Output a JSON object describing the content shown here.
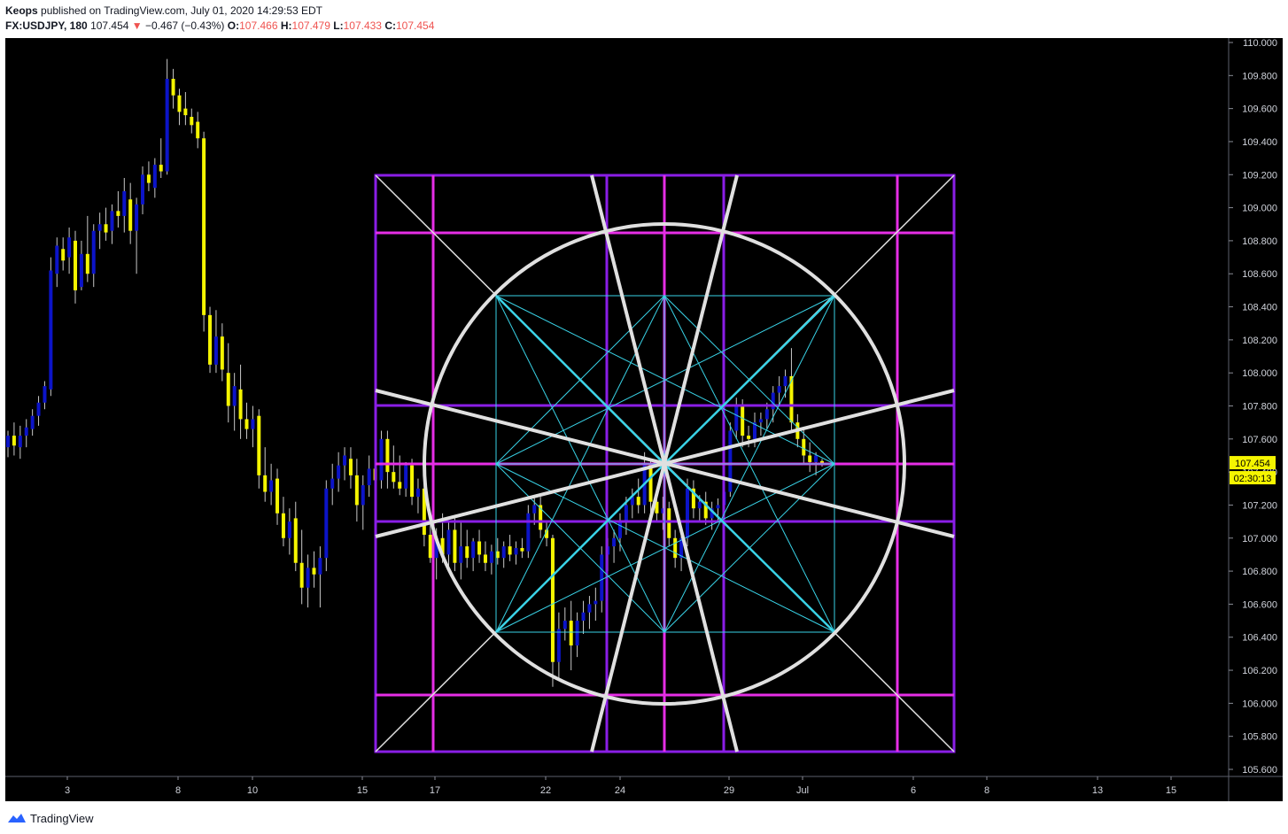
{
  "header": {
    "author": "Keops",
    "published_text": "published on TradingView.com, July 01, 2020 14:29:53 EDT",
    "symbol": "FX:USDJPY, 180",
    "last": "107.454",
    "change_arrow": "▼",
    "change": "−0.467 (−0.43%)",
    "o_label": "O:",
    "o_value": "107.466",
    "h_label": "H:",
    "h_value": "107.479",
    "l_label": "L:",
    "l_value": "107.433",
    "c_label": "C:",
    "c_value": "107.454"
  },
  "footer": {
    "brand": "TradingView",
    "logo_icon": "tradingview-logo-icon"
  },
  "colors": {
    "background": "#000000",
    "candle_up": "#0c14c8",
    "candle_down": "#f5f500",
    "frame": "#8a1ee6",
    "grid_magenta": "#e62ee6",
    "circle_and_rays": "#e0e0e0",
    "inner_lines": "#39d2e6",
    "price_tag_bg": "#f5f500"
  },
  "chart_data": {
    "type": "candlestick",
    "ylim": [
      105.55,
      110.04
    ],
    "y_ticks": [
      "110.000",
      "109.800",
      "109.600",
      "109.400",
      "109.200",
      "109.000",
      "108.800",
      "108.600",
      "108.400",
      "108.200",
      "108.000",
      "107.800",
      "107.600",
      "107.400",
      "107.200",
      "107.000",
      "106.800",
      "106.600",
      "106.400",
      "106.200",
      "106.000",
      "105.800",
      "105.600"
    ],
    "x_ticks": [
      "3",
      "8",
      "10",
      "15",
      "17",
      "22",
      "24",
      "29",
      "Jul",
      "6",
      "8",
      "13",
      "15"
    ],
    "last_price_label": "107.454",
    "countdown_label": "02:30:13",
    "candles": [
      {
        "o": 107.55,
        "h": 107.65,
        "l": 107.49,
        "c": 107.62
      },
      {
        "o": 107.62,
        "h": 107.7,
        "l": 107.5,
        "c": 107.56
      },
      {
        "o": 107.55,
        "h": 107.68,
        "l": 107.48,
        "c": 107.62
      },
      {
        "o": 107.62,
        "h": 107.72,
        "l": 107.55,
        "c": 107.67
      },
      {
        "o": 107.66,
        "h": 107.78,
        "l": 107.62,
        "c": 107.74
      },
      {
        "o": 107.74,
        "h": 107.86,
        "l": 107.68,
        "c": 107.82
      },
      {
        "o": 107.82,
        "h": 107.95,
        "l": 107.78,
        "c": 107.92
      },
      {
        "o": 107.9,
        "h": 108.7,
        "l": 107.86,
        "c": 108.62
      },
      {
        "o": 108.6,
        "h": 108.82,
        "l": 108.52,
        "c": 108.77
      },
      {
        "o": 108.75,
        "h": 108.82,
        "l": 108.62,
        "c": 108.68
      },
      {
        "o": 108.7,
        "h": 108.88,
        "l": 108.6,
        "c": 108.82
      },
      {
        "o": 108.8,
        "h": 108.86,
        "l": 108.42,
        "c": 108.5
      },
      {
        "o": 108.52,
        "h": 108.8,
        "l": 108.5,
        "c": 108.72
      },
      {
        "o": 108.72,
        "h": 108.95,
        "l": 108.55,
        "c": 108.6
      },
      {
        "o": 108.6,
        "h": 108.9,
        "l": 108.52,
        "c": 108.86
      },
      {
        "o": 108.86,
        "h": 108.97,
        "l": 108.75,
        "c": 108.9
      },
      {
        "o": 108.9,
        "h": 109.0,
        "l": 108.8,
        "c": 108.85
      },
      {
        "o": 108.86,
        "h": 109.02,
        "l": 108.78,
        "c": 108.98
      },
      {
        "o": 108.98,
        "h": 109.1,
        "l": 108.88,
        "c": 108.95
      },
      {
        "o": 108.95,
        "h": 109.18,
        "l": 108.85,
        "c": 109.1
      },
      {
        "o": 109.05,
        "h": 109.15,
        "l": 108.78,
        "c": 108.86
      },
      {
        "o": 108.86,
        "h": 109.06,
        "l": 108.6,
        "c": 109.02
      },
      {
        "o": 109.02,
        "h": 109.25,
        "l": 108.96,
        "c": 109.2
      },
      {
        "o": 109.2,
        "h": 109.28,
        "l": 109.1,
        "c": 109.15
      },
      {
        "o": 109.12,
        "h": 109.3,
        "l": 109.06,
        "c": 109.26
      },
      {
        "o": 109.26,
        "h": 109.42,
        "l": 109.18,
        "c": 109.22
      },
      {
        "o": 109.22,
        "h": 109.9,
        "l": 109.2,
        "c": 109.78
      },
      {
        "o": 109.78,
        "h": 109.84,
        "l": 109.6,
        "c": 109.68
      },
      {
        "o": 109.68,
        "h": 109.72,
        "l": 109.5,
        "c": 109.58
      },
      {
        "o": 109.6,
        "h": 109.7,
        "l": 109.5,
        "c": 109.56
      },
      {
        "o": 109.55,
        "h": 109.6,
        "l": 109.45,
        "c": 109.5
      },
      {
        "o": 109.52,
        "h": 109.58,
        "l": 109.36,
        "c": 109.42
      },
      {
        "o": 109.42,
        "h": 109.46,
        "l": 108.25,
        "c": 108.35
      },
      {
        "o": 108.35,
        "h": 108.4,
        "l": 108.0,
        "c": 108.05
      },
      {
        "o": 108.05,
        "h": 108.38,
        "l": 108.0,
        "c": 108.22
      },
      {
        "o": 108.22,
        "h": 108.3,
        "l": 107.95,
        "c": 108.02
      },
      {
        "o": 108.0,
        "h": 108.18,
        "l": 107.7,
        "c": 107.8
      },
      {
        "o": 107.8,
        "h": 108.0,
        "l": 107.65,
        "c": 107.92
      },
      {
        "o": 107.9,
        "h": 108.05,
        "l": 107.6,
        "c": 107.72
      },
      {
        "o": 107.72,
        "h": 107.82,
        "l": 107.6,
        "c": 107.66
      },
      {
        "o": 107.66,
        "h": 107.8,
        "l": 107.55,
        "c": 107.72
      },
      {
        "o": 107.74,
        "h": 107.78,
        "l": 107.3,
        "c": 107.38
      },
      {
        "o": 107.38,
        "h": 107.55,
        "l": 107.22,
        "c": 107.28
      },
      {
        "o": 107.28,
        "h": 107.45,
        "l": 107.2,
        "c": 107.35
      },
      {
        "o": 107.36,
        "h": 107.42,
        "l": 107.08,
        "c": 107.15
      },
      {
        "o": 107.15,
        "h": 107.25,
        "l": 106.95,
        "c": 107.0
      },
      {
        "o": 107.0,
        "h": 107.18,
        "l": 106.9,
        "c": 107.1
      },
      {
        "o": 107.12,
        "h": 107.22,
        "l": 106.8,
        "c": 106.85
      },
      {
        "o": 106.85,
        "h": 107.05,
        "l": 106.6,
        "c": 106.7
      },
      {
        "o": 106.7,
        "h": 106.9,
        "l": 106.58,
        "c": 106.82
      },
      {
        "o": 106.82,
        "h": 106.92,
        "l": 106.7,
        "c": 106.78
      },
      {
        "o": 106.78,
        "h": 106.95,
        "l": 106.58,
        "c": 106.88
      },
      {
        "o": 106.88,
        "h": 107.35,
        "l": 106.8,
        "c": 107.3
      },
      {
        "o": 107.3,
        "h": 107.45,
        "l": 107.2,
        "c": 107.36
      },
      {
        "o": 107.36,
        "h": 107.52,
        "l": 107.28,
        "c": 107.44
      },
      {
        "o": 107.44,
        "h": 107.55,
        "l": 107.35,
        "c": 107.5
      },
      {
        "o": 107.48,
        "h": 107.55,
        "l": 107.3,
        "c": 107.38
      },
      {
        "o": 107.38,
        "h": 107.48,
        "l": 107.1,
        "c": 107.2
      },
      {
        "o": 107.2,
        "h": 107.38,
        "l": 107.05,
        "c": 107.32
      },
      {
        "o": 107.32,
        "h": 107.5,
        "l": 107.25,
        "c": 107.42
      },
      {
        "o": 107.42,
        "h": 107.6,
        "l": 107.3,
        "c": 107.35
      },
      {
        "o": 107.35,
        "h": 107.65,
        "l": 107.3,
        "c": 107.6
      },
      {
        "o": 107.6,
        "h": 107.65,
        "l": 107.3,
        "c": 107.4
      },
      {
        "o": 107.4,
        "h": 107.56,
        "l": 107.3,
        "c": 107.34
      },
      {
        "o": 107.34,
        "h": 107.5,
        "l": 107.26,
        "c": 107.3
      },
      {
        "o": 107.3,
        "h": 107.46,
        "l": 107.25,
        "c": 107.44
      },
      {
        "o": 107.44,
        "h": 107.48,
        "l": 107.2,
        "c": 107.25
      },
      {
        "o": 107.25,
        "h": 107.36,
        "l": 107.15,
        "c": 107.3
      },
      {
        "o": 107.3,
        "h": 107.34,
        "l": 106.95,
        "c": 107.02
      },
      {
        "o": 107.02,
        "h": 107.1,
        "l": 106.85,
        "c": 106.88
      },
      {
        "o": 106.88,
        "h": 107.06,
        "l": 106.75,
        "c": 107.0
      },
      {
        "o": 107.0,
        "h": 107.15,
        "l": 106.85,
        "c": 106.9
      },
      {
        "o": 106.9,
        "h": 107.1,
        "l": 106.8,
        "c": 107.05
      },
      {
        "o": 107.05,
        "h": 107.12,
        "l": 106.8,
        "c": 106.85
      },
      {
        "o": 106.85,
        "h": 107.1,
        "l": 106.75,
        "c": 106.95
      },
      {
        "o": 106.95,
        "h": 107.05,
        "l": 106.82,
        "c": 106.88
      },
      {
        "o": 106.88,
        "h": 107.0,
        "l": 106.8,
        "c": 106.98
      },
      {
        "o": 106.98,
        "h": 107.05,
        "l": 106.85,
        "c": 106.9
      },
      {
        "o": 106.9,
        "h": 106.98,
        "l": 106.8,
        "c": 106.85
      },
      {
        "o": 106.85,
        "h": 106.96,
        "l": 106.78,
        "c": 106.92
      },
      {
        "o": 106.92,
        "h": 107.0,
        "l": 106.84,
        "c": 106.88
      },
      {
        "o": 106.88,
        "h": 106.98,
        "l": 106.82,
        "c": 106.95
      },
      {
        "o": 106.95,
        "h": 107.02,
        "l": 106.86,
        "c": 106.9
      },
      {
        "o": 106.9,
        "h": 106.98,
        "l": 106.84,
        "c": 106.94
      },
      {
        "o": 106.94,
        "h": 107.0,
        "l": 106.88,
        "c": 106.92
      },
      {
        "o": 106.92,
        "h": 107.2,
        "l": 106.88,
        "c": 107.15
      },
      {
        "o": 107.15,
        "h": 107.25,
        "l": 107.08,
        "c": 107.2
      },
      {
        "o": 107.2,
        "h": 107.25,
        "l": 107.0,
        "c": 107.05
      },
      {
        "o": 107.05,
        "h": 107.1,
        "l": 106.95,
        "c": 107.0
      },
      {
        "o": 107.0,
        "h": 107.02,
        "l": 106.1,
        "c": 106.25
      },
      {
        "o": 106.25,
        "h": 106.55,
        "l": 106.15,
        "c": 106.45
      },
      {
        "o": 106.45,
        "h": 106.58,
        "l": 106.38,
        "c": 106.5
      },
      {
        "o": 106.5,
        "h": 106.62,
        "l": 106.2,
        "c": 106.35
      },
      {
        "o": 106.35,
        "h": 106.55,
        "l": 106.28,
        "c": 106.5
      },
      {
        "o": 106.5,
        "h": 106.62,
        "l": 106.42,
        "c": 106.55
      },
      {
        "o": 106.55,
        "h": 106.65,
        "l": 106.45,
        "c": 106.6
      },
      {
        "o": 106.6,
        "h": 106.7,
        "l": 106.5,
        "c": 106.62
      },
      {
        "o": 106.62,
        "h": 106.95,
        "l": 106.55,
        "c": 106.9
      },
      {
        "o": 106.9,
        "h": 107.0,
        "l": 106.8,
        "c": 106.95
      },
      {
        "o": 106.95,
        "h": 107.05,
        "l": 106.85,
        "c": 107.0
      },
      {
        "o": 107.0,
        "h": 107.15,
        "l": 106.92,
        "c": 107.1
      },
      {
        "o": 107.1,
        "h": 107.25,
        "l": 107.02,
        "c": 107.2
      },
      {
        "o": 107.2,
        "h": 107.3,
        "l": 107.12,
        "c": 107.25
      },
      {
        "o": 107.25,
        "h": 107.36,
        "l": 107.15,
        "c": 107.2
      },
      {
        "o": 107.2,
        "h": 107.52,
        "l": 107.15,
        "c": 107.45
      },
      {
        "o": 107.45,
        "h": 107.48,
        "l": 107.15,
        "c": 107.22
      },
      {
        "o": 107.22,
        "h": 107.3,
        "l": 107.1,
        "c": 107.15
      },
      {
        "o": 107.15,
        "h": 107.25,
        "l": 107.05,
        "c": 107.18
      },
      {
        "o": 107.18,
        "h": 107.22,
        "l": 106.95,
        "c": 107.0
      },
      {
        "o": 107.0,
        "h": 107.05,
        "l": 106.82,
        "c": 106.88
      },
      {
        "o": 106.88,
        "h": 107.05,
        "l": 106.8,
        "c": 107.0
      },
      {
        "o": 107.0,
        "h": 107.36,
        "l": 106.95,
        "c": 107.3
      },
      {
        "o": 107.3,
        "h": 107.35,
        "l": 107.12,
        "c": 107.18
      },
      {
        "o": 107.18,
        "h": 107.26,
        "l": 107.1,
        "c": 107.22
      },
      {
        "o": 107.22,
        "h": 107.28,
        "l": 107.08,
        "c": 107.12
      },
      {
        "o": 107.12,
        "h": 107.22,
        "l": 107.05,
        "c": 107.18
      },
      {
        "o": 107.18,
        "h": 107.24,
        "l": 107.1,
        "c": 107.2
      },
      {
        "o": 107.2,
        "h": 107.32,
        "l": 107.15,
        "c": 107.28
      },
      {
        "o": 107.28,
        "h": 107.7,
        "l": 107.25,
        "c": 107.65
      },
      {
        "o": 107.65,
        "h": 107.85,
        "l": 107.6,
        "c": 107.8
      },
      {
        "o": 107.8,
        "h": 107.84,
        "l": 107.55,
        "c": 107.62
      },
      {
        "o": 107.62,
        "h": 107.68,
        "l": 107.55,
        "c": 107.6
      },
      {
        "o": 107.6,
        "h": 107.76,
        "l": 107.55,
        "c": 107.7
      },
      {
        "o": 107.7,
        "h": 107.76,
        "l": 107.62,
        "c": 107.72
      },
      {
        "o": 107.72,
        "h": 107.82,
        "l": 107.66,
        "c": 107.78
      },
      {
        "o": 107.78,
        "h": 107.92,
        "l": 107.7,
        "c": 107.88
      },
      {
        "o": 107.88,
        "h": 107.98,
        "l": 107.8,
        "c": 107.92
      },
      {
        "o": 107.92,
        "h": 108.02,
        "l": 107.85,
        "c": 107.98
      },
      {
        "o": 107.98,
        "h": 108.15,
        "l": 107.65,
        "c": 107.7
      },
      {
        "o": 107.7,
        "h": 107.75,
        "l": 107.55,
        "c": 107.6
      },
      {
        "o": 107.6,
        "h": 107.66,
        "l": 107.45,
        "c": 107.5
      },
      {
        "o": 107.5,
        "h": 107.58,
        "l": 107.4,
        "c": 107.46
      },
      {
        "o": 107.46,
        "h": 107.52,
        "l": 107.38,
        "c": 107.5
      },
      {
        "o": 107.466,
        "h": 107.479,
        "l": 107.433,
        "c": 107.454
      }
    ]
  }
}
